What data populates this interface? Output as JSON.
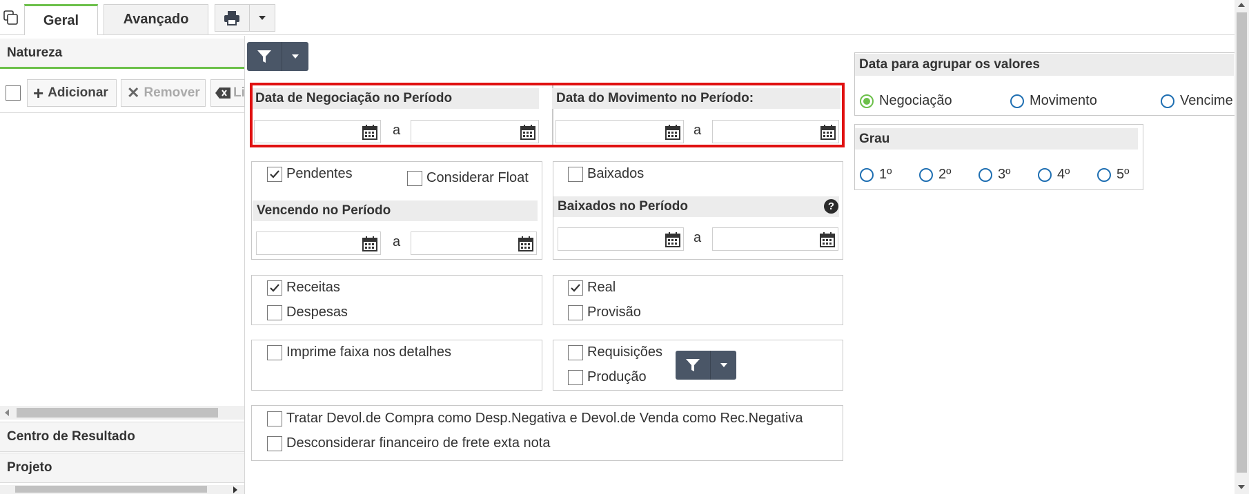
{
  "tabs": [
    {
      "label": "Geral",
      "active": true
    },
    {
      "label": "Avançado",
      "active": false
    }
  ],
  "left_panel": {
    "natureza_title": "Natureza",
    "toolbar": {
      "add_label": "Adicionar",
      "remove_label": "Remover",
      "clear_label": "Li"
    },
    "centro_title": "Centro de Resultado",
    "projeto_title": "Projeto"
  },
  "periods": {
    "negociacao_title": "Data de Negociação no Período",
    "movimento_title": "Data do Movimento no Período:",
    "range_sep": "a"
  },
  "pendentes": {
    "pendentes_label": "Pendentes",
    "pendentes_checked": true,
    "float_label": "Considerar Float",
    "float_checked": false,
    "vencendo_title": "Vencendo no Período",
    "range_sep": "a"
  },
  "baixados": {
    "baixados_label": "Baixados",
    "baixados_checked": false,
    "periodo_title": "Baixados no Período",
    "range_sep": "a"
  },
  "tipo": {
    "receitas_label": "Receitas",
    "receitas_checked": true,
    "despesas_label": "Despesas",
    "despesas_checked": false
  },
  "origem": {
    "real_label": "Real",
    "real_checked": true,
    "provisao_label": "Provisão",
    "provisao_checked": false
  },
  "imprime": {
    "label": "Imprime faixa nos detalhes",
    "checked": false
  },
  "req": {
    "requisicoes_label": "Requisições",
    "requisicoes_checked": false,
    "producao_label": "Produção",
    "producao_checked": false
  },
  "devol": {
    "tratar_label": "Tratar Devol.de Compra como Desp.Negativa e Devol.de Venda como Rec.Negativa",
    "tratar_checked": false,
    "frete_label": "Desconsiderar financeiro de frete exta nota",
    "frete_checked": false
  },
  "agrupar": {
    "title": "Data para agrupar os valores",
    "options": [
      "Negociação",
      "Movimento",
      "Vencime"
    ],
    "selected": "Negociação"
  },
  "grau": {
    "title": "Grau",
    "options": [
      "1º",
      "2º",
      "3º",
      "4º",
      "5º"
    ]
  },
  "colors": {
    "accent_green": "#6cc04a",
    "radio_blue": "#1f6fb2",
    "highlight_red": "#e01010",
    "dark_button": "#4a5667"
  }
}
